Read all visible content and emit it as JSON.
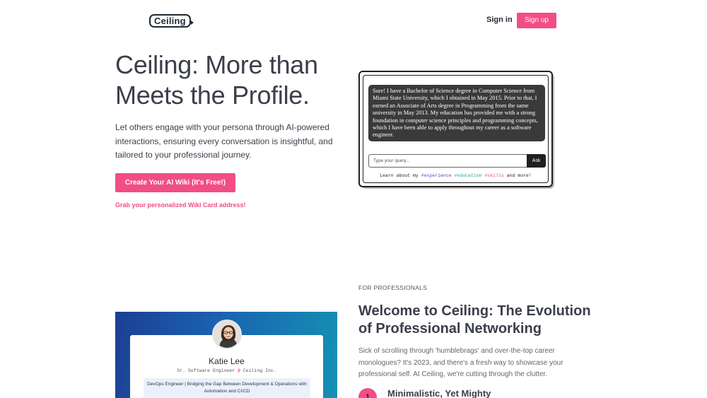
{
  "header": {
    "logo_text": "Ceiling",
    "signin_label": "Sign in",
    "signup_label": "Sign up"
  },
  "hero": {
    "title": "Ceiling: More than Meets the Profile.",
    "description": "Let others engage with your persona through AI-powered interactions, ensuring every conversation is insightful, and tailored to your professional journey.",
    "cta_label": "Create Your AI Wiki (It's Free!)",
    "cta_sub": "Grab your personalized Wiki Card address!"
  },
  "chat_card": {
    "response": "Sure! I have a Bachelor of Science degree in Computer Science from Miami State University, which I obtained in May 2015. Prior to that, I earned an Associate of Arts degree in Programming from the same university in May 2013. My education has provided me with a strong foundation in computer science principles and programming concepts, which I have been able to apply throughout my career as a software engineer.",
    "query_placeholder": "Type your query...",
    "ask_label": "Ask",
    "learn_prefix": "Learn about my",
    "tag_experience": "#experience",
    "tag_education": "#education",
    "tag_skills": "#skills",
    "learn_suffix": "and more!"
  },
  "section2": {
    "eyebrow": "FOR PROFESSIONALS",
    "title": "Welcome to Ceiling: The Evolution of Professional Networking",
    "description": "Sick of scrolling through 'humblebrags' and over-the-top career monologues? It's 2023, and there's a fresh way to showcase your professional self. At Ceiling, we're cutting through the clutter.",
    "step_number": "1",
    "step_title": "Minimalistic, Yet Mighty"
  },
  "profile": {
    "name": "Katie Lee",
    "role_prefix": "Sr. Software Engineer",
    "role_at": "@",
    "role_company": "Ceiling Inc.",
    "bio": "DevOps Engineer | Bridging the Gap Between Development & Operations with Automation and CI/CD"
  },
  "colors": {
    "accent": "#f24d86",
    "text": "#3b3f4a"
  }
}
